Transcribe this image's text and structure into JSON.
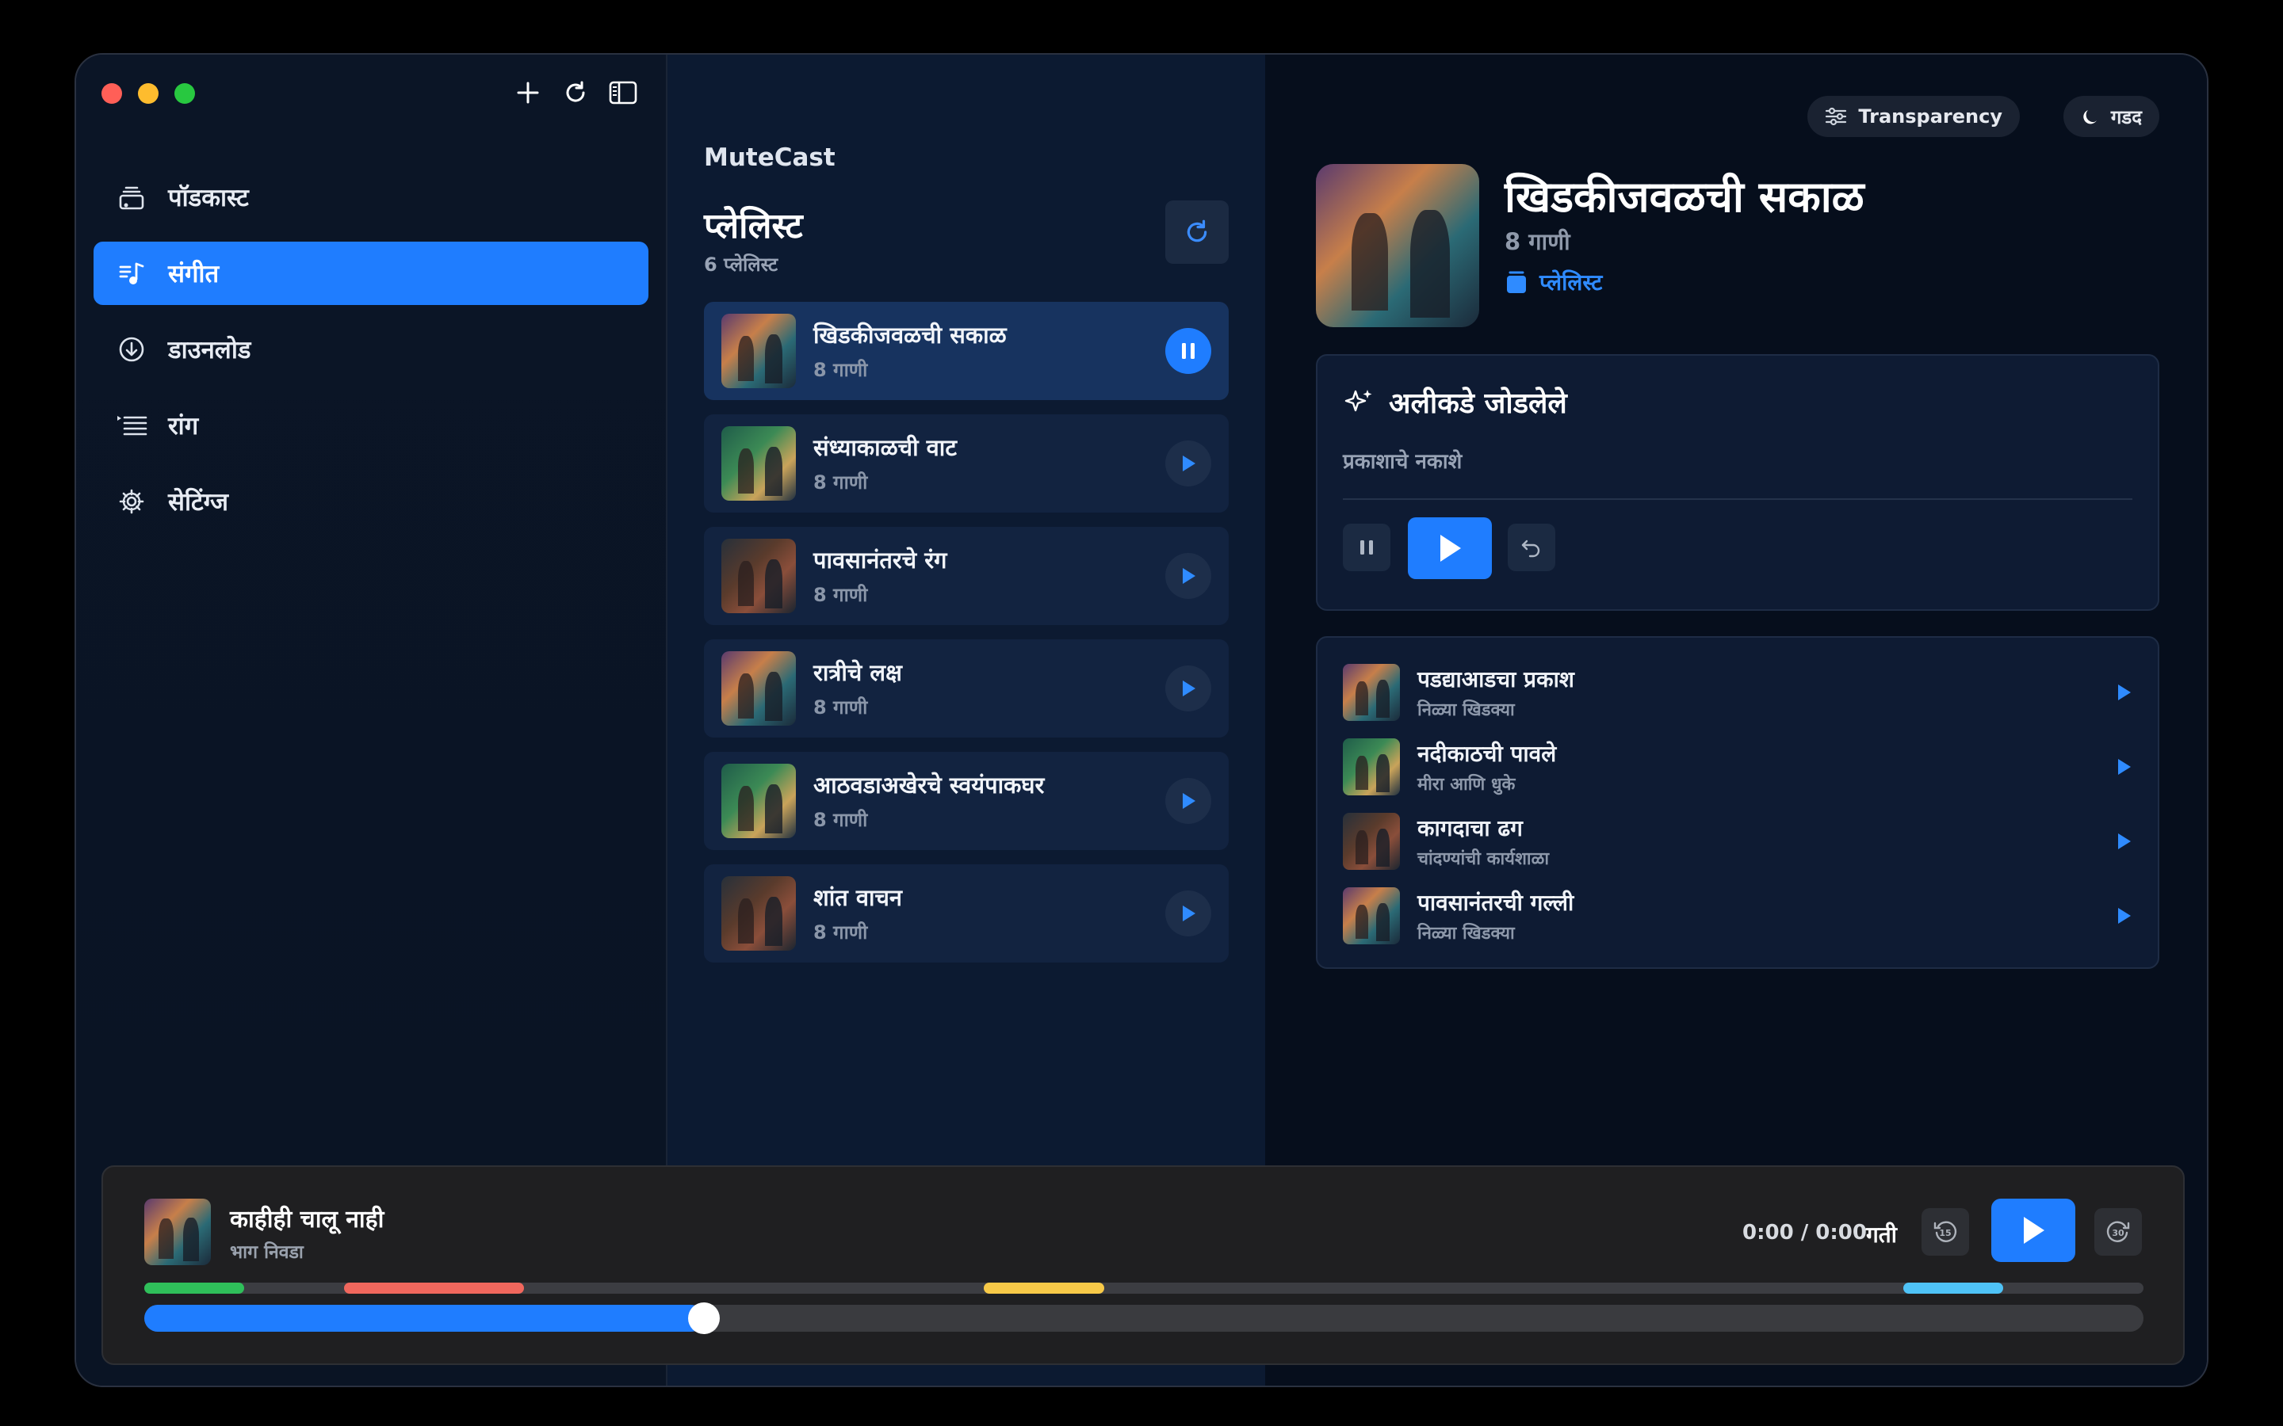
{
  "sidebar": {
    "items": [
      {
        "label": "पॉडकास्ट",
        "icon": "podcast-stack-icon",
        "active": false
      },
      {
        "label": "संगीत",
        "icon": "music-note-icon",
        "active": true
      },
      {
        "label": "डाउनलोड",
        "icon": "download-icon",
        "active": false
      },
      {
        "label": "रांग",
        "icon": "queue-list-icon",
        "active": false
      },
      {
        "label": "सेटिंग्ज",
        "icon": "gear-icon",
        "active": false
      }
    ]
  },
  "middle": {
    "app_name": "MuteCast",
    "title": "प्लेलिस्ट",
    "count": "6 प्लेलिस्ट",
    "playlists": [
      {
        "name": "खिडकीजवळची सकाळ",
        "sub": "8 गाणी",
        "state": "playing"
      },
      {
        "name": "संध्याकाळची वाट",
        "sub": "8 गाणी",
        "state": "idle"
      },
      {
        "name": "पावसानंतरचे रंग",
        "sub": "8 गाणी",
        "state": "idle"
      },
      {
        "name": "रात्रीचे लक्ष",
        "sub": "8 गाणी",
        "state": "idle"
      },
      {
        "name": "आठवडाअखेरचे स्वयंपाकघर",
        "sub": "8 गाणी",
        "state": "idle"
      },
      {
        "name": "शांत वाचन",
        "sub": "8 गाणी",
        "state": "idle"
      }
    ]
  },
  "right": {
    "transparency_label": "Transparency",
    "theme_label": "गडद",
    "hero": {
      "title": "खिडकीजवळची सकाळ",
      "sub": "8 गाणी",
      "link": "प्लेलिस्ट"
    },
    "recent": {
      "title": "अलीकडे जोडलेले",
      "sub": "प्रकाशाचे नकाशे"
    },
    "tracks": [
      {
        "name": "पडद्याआडचा प्रकाश",
        "sub": "निळ्या खिडक्या"
      },
      {
        "name": "नदीकाठची पावले",
        "sub": "मीरा आणि धुके"
      },
      {
        "name": "कागदाचा ढग",
        "sub": "चांदण्यांची कार्यशाळा"
      },
      {
        "name": "पावसानंतरची गल्ली",
        "sub": "निळ्या खिडक्या"
      }
    ]
  },
  "player": {
    "title": "काहीही चालू नाही",
    "sub": "भाग निवडा",
    "time": "0:00 / 0:00",
    "speed": "गती",
    "progress": 0.28,
    "chapters": [
      {
        "color": "#2fbf5a",
        "start": 0.0,
        "end": 0.05
      },
      {
        "color": "#f0675d",
        "start": 0.1,
        "end": 0.19
      },
      {
        "color": "#f7c948",
        "start": 0.42,
        "end": 0.48
      },
      {
        "color": "#4fc3f7",
        "start": 0.88,
        "end": 0.93
      }
    ]
  },
  "colors": {
    "accent": "#1f7dff",
    "red": "#ff5f57",
    "yellow": "#febc2e",
    "green": "#28c840"
  }
}
